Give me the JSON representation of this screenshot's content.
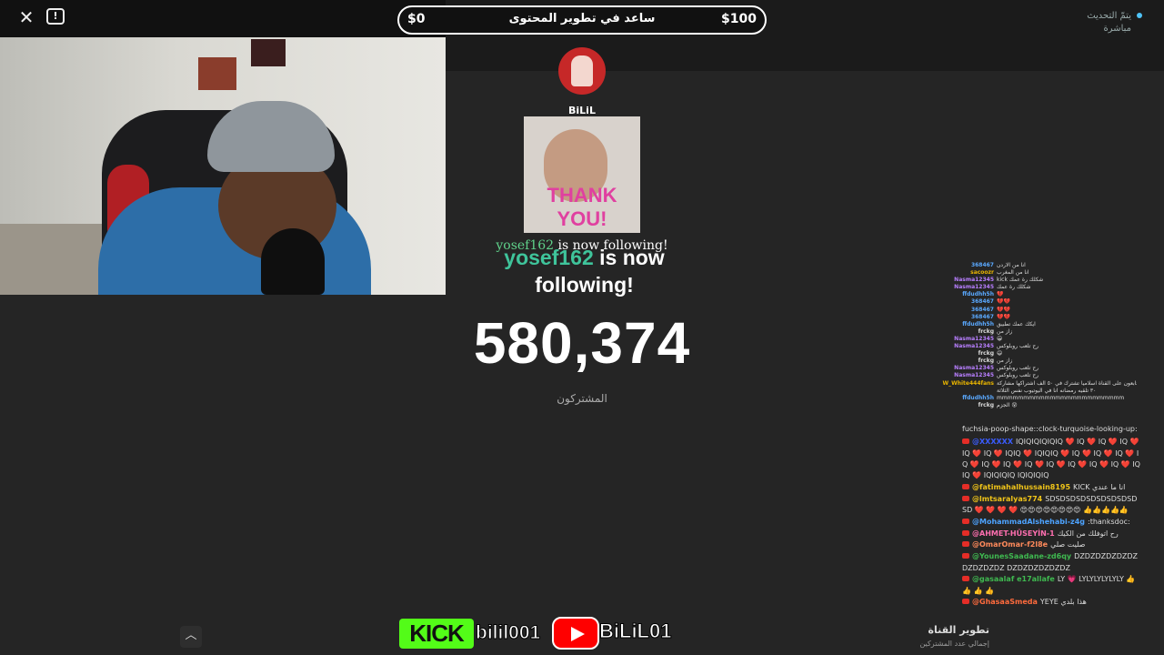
{
  "header": {
    "close_icon": "close-icon",
    "report_icon": "report-icon",
    "goal_low": "$0",
    "goal_high": "$100",
    "goal_title": "ساعد في تطوير المحتوى",
    "status_line1": "يتمّ التحديث",
    "status_line2": "مباشرة",
    "status_dot_color": "#4fc3f7"
  },
  "stream": {
    "channel_name": "BiLiL",
    "thanks_text": "THANK YOU!",
    "follow_small_user": "yosef162",
    "follow_small_text": "is now following!",
    "follow_big_user": "yosef162",
    "follow_big_text": "is now following!",
    "subscriber_count": "580,374",
    "subscriber_label": "المشتركون"
  },
  "mini_chat": [
    {
      "user": "368467",
      "msg": "انا من الاردن",
      "color": "#5aa9ff"
    },
    {
      "user": "sacoozr",
      "msg": "انا من المغرب",
      "color": "#e8b400"
    },
    {
      "user": "Nasma12345",
      "msg": "kick شكلك رة عمك",
      "color": "#b87fff"
    },
    {
      "user": "Nasma12345",
      "msg": "شكلك رة عمك",
      "color": "#b87fff"
    },
    {
      "user": "ffdudhh5h",
      "msg": "💔",
      "color": "#5aa9ff"
    },
    {
      "user": "368467",
      "msg": "💔💔",
      "color": "#5aa9ff"
    },
    {
      "user": "368467",
      "msg": "💔💔",
      "color": "#5aa9ff"
    },
    {
      "user": "368467",
      "msg": "💔💔",
      "color": "#5aa9ff"
    },
    {
      "user": "ffdudhh5h",
      "msg": "ايكك عمك تطبيق",
      "color": "#5aa9ff"
    },
    {
      "user": "frckg",
      "msg": "زاز من",
      "color": "#ddd"
    },
    {
      "user": "Nasma12345",
      "msg": "😀",
      "color": "#b87fff"
    },
    {
      "user": "Nasma12345",
      "msg": "رح تلعب روبلوكس",
      "color": "#b87fff"
    },
    {
      "user": "frckg",
      "msg": "😄",
      "color": "#ddd"
    },
    {
      "user": "frckg",
      "msg": "زاز من",
      "color": "#ddd"
    },
    {
      "user": "Nasma12345",
      "msg": "رح تلعب روبلوكس",
      "color": "#b87fff"
    },
    {
      "user": "Nasma12345",
      "msg": "رح تلعب روبلوكس",
      "color": "#b87fff"
    },
    {
      "user": "W_White444fans",
      "msg": "عندي أي اليوتيوب يتابعون على القناة اسلاميا تشترك في ٥٠ الف اشتراكها مشاركة",
      "color": "#e8b400"
    },
    {
      "user": "",
      "msg": "٣٠ تلقيه رمضانه انا في اليوتيوب نفس الثلاثة",
      "color": "#ddd"
    },
    {
      "user": "ffdudhh5h",
      "msg": "mmmmmmmmmmmmmmmmmmmmmmmm",
      "color": "#5aa9ff"
    },
    {
      "user": "frckg",
      "msg": "الجزم 😵",
      "color": "#ddd"
    }
  ],
  "chat": {
    "head": "fuchsia-poop-shape::clock-turquoise-looking-up:",
    "messages": [
      {
        "user": "@XXXXXX",
        "color": "#3a5cff",
        "msg": "IQIQIQIQIQIQ ❤️ IQ ❤️ IQ ❤️ IQ ❤️ IQ ❤️ IQ ❤️ IQIQ ❤️ IQIQIQ ❤️ IQ ❤️ IQ ❤️ IQ ❤️ IQ ❤️ IQ ❤️ IQ ❤️ IQ ❤️ IQ ❤️ IQ ❤️ IQ ❤️ IQ ❤️ IQIQ ❤️ IQIQIQIQ IQIQIQIQ"
      },
      {
        "user": "@fatimahalhussain8195",
        "color": "#f0c419",
        "msg": "KICK انا ما عندي"
      },
      {
        "user": "@lmtsaralyas774",
        "color": "#f0c419",
        "msg": "SDSDSDSDSDSDSDSDSDSD ❤️ ❤️ ❤️ ❤️ 😍😍😍😍😍😍😍😍 👍👍👍👍👍"
      },
      {
        "user": "@MohammadAlshehabi-z4g",
        "color": "#4da3ff",
        "msg": ":thanksdoc:"
      },
      {
        "user": "@AHMET-HÜSEYİN-1",
        "color": "#ff6fb0",
        "msg": "رح اتوفلك من الكيك"
      },
      {
        "user": "@OmarOmar-f2l8e",
        "color": "#ff8a5b",
        "msg": "صليت صلي"
      },
      {
        "user": "@YounesSaadane-zd6qy",
        "color": "#3fb950",
        "msg": "DZDZDZDZDZDZDZDZDZDZ DZDZDZDZDZDZ"
      },
      {
        "user": "@gasaalaf e17allafe",
        "color": "#3fb950",
        "msg": "LY 💗 LYLYLYLYLYLY 👍 👍 👍 👍"
      },
      {
        "user": "@GhasaaSmeda",
        "color": "#ff6b3d",
        "msg": "YEYE هذا بلدي"
      }
    ]
  },
  "footer": {
    "title": "تطوير القناة",
    "subtitle": "إجمالي عدد المشتركين",
    "scroll_icon": "chevron-up-icon",
    "kick_logo": "KICK",
    "kick_handle": "bilil001",
    "yt_handle": "BiLiL01"
  }
}
